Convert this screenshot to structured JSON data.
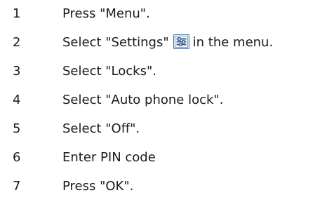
{
  "steps": [
    {
      "number": "1",
      "text": "Press \"Menu\"."
    },
    {
      "number": "2",
      "text_before": "Select \"Settings\"",
      "icon": "settings-icon",
      "text_after": "in the menu."
    },
    {
      "number": "3",
      "text": "Select \"Locks\"."
    },
    {
      "number": "4",
      "text": "Select \"Auto phone lock\"."
    },
    {
      "number": "5",
      "text": "Select \"Off\"."
    },
    {
      "number": "6",
      "text": "Enter PIN code"
    },
    {
      "number": "7",
      "text": "Press \"OK\"."
    }
  ]
}
